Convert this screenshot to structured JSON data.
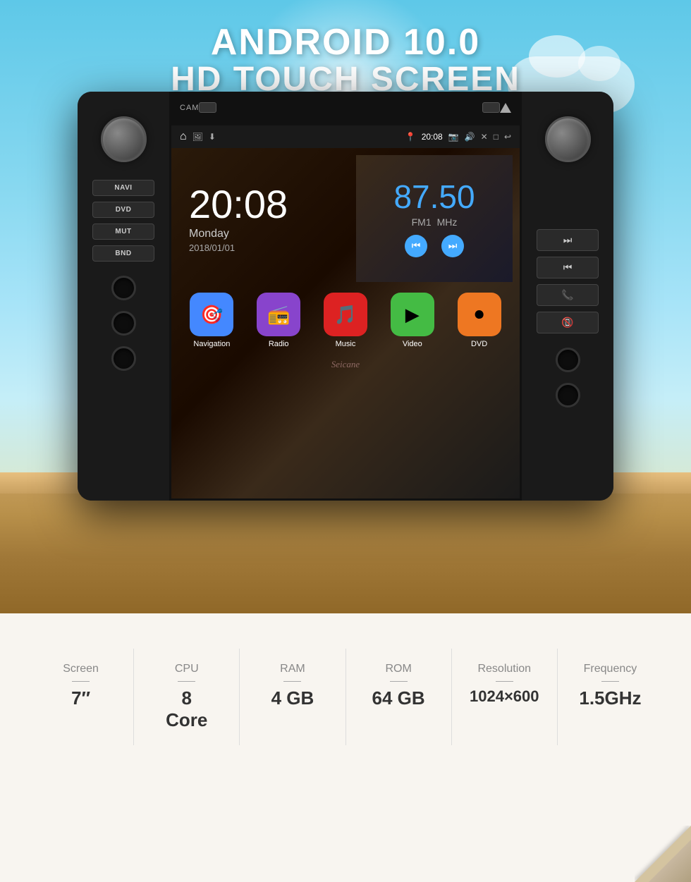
{
  "hero": {
    "title_line1": "ANDROID 10.0",
    "title_line2": "HD TOUCH SCREEN"
  },
  "device": {
    "top_bar": {
      "cam_label": "CAM",
      "btn1": "",
      "btn2": "▲"
    },
    "status_bar": {
      "time": "20:08",
      "icons": [
        "📍",
        "📷",
        "🔊",
        "✕",
        "□",
        "↩"
      ]
    },
    "screen": {
      "time": "20:08",
      "day": "Monday",
      "date": "2018/01/01",
      "frequency": "87.50",
      "radio_band": "FM1",
      "radio_unit": "MHz",
      "watermark": "Seicane"
    },
    "buttons_left": [
      "NAVI",
      "DVD",
      "MUT",
      "BND"
    ],
    "apps": [
      {
        "name": "Navigation",
        "color": "nav-color",
        "icon": "🎯"
      },
      {
        "name": "Radio",
        "color": "radio-color",
        "icon": "📻"
      },
      {
        "name": "Music",
        "color": "music-color",
        "icon": "🎵"
      },
      {
        "name": "Video",
        "color": "video-color",
        "icon": "▶"
      },
      {
        "name": "DVD",
        "color": "dvd-color",
        "icon": "⏺"
      }
    ]
  },
  "specs": [
    {
      "label": "Screen",
      "value": "7″"
    },
    {
      "label": "CPU",
      "value": "8\nCore"
    },
    {
      "label": "RAM",
      "value": "4 GB"
    },
    {
      "label": "ROM",
      "value": "64 GB"
    },
    {
      "label": "Resolution",
      "value": "1024×600"
    },
    {
      "label": "Frequency",
      "value": "1.5GHz"
    }
  ]
}
